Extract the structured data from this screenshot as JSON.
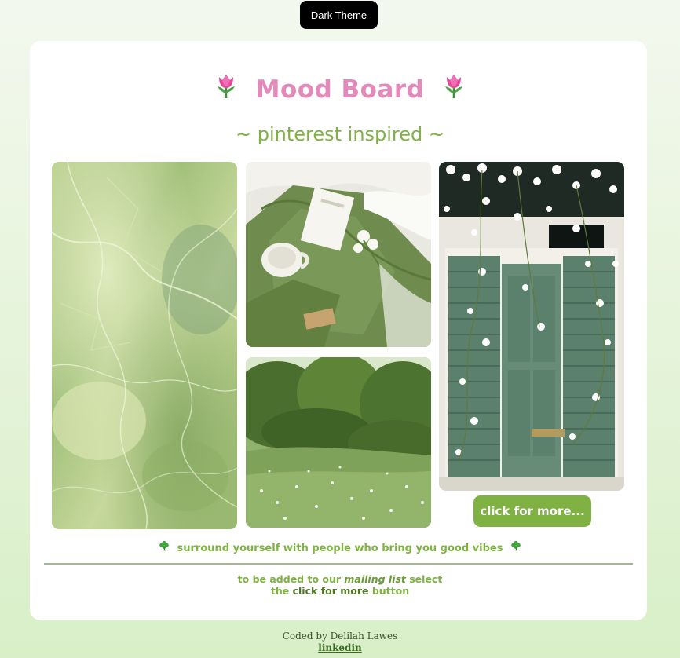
{
  "toolbar": {
    "theme_button_label": "Dark Theme"
  },
  "header": {
    "title": "Mood Board",
    "subtitle": "~ pinterest inspired ~",
    "title_emoji": "🌷"
  },
  "gallery": {
    "images": [
      {
        "name": "green-marble-image"
      },
      {
        "name": "green-apron-flatlay-image"
      },
      {
        "name": "wildflower-meadow-image"
      },
      {
        "name": "green-door-flowers-image"
      }
    ],
    "more_button_label": "click for more..."
  },
  "vibes": {
    "text": "surround yourself with people who bring you good vibes",
    "emoji": "🍀"
  },
  "mailing": {
    "part1": "to be added to our ",
    "list_label": "mailing list",
    "part2": " select",
    "part3": "the ",
    "button_ref": "click for more",
    "part4": " button"
  },
  "footer": {
    "credit": "Coded by Delilah Lawes",
    "link_label": "linkedin"
  },
  "colors": {
    "title_pink": "#e48aba",
    "accent_green": "#7fb143",
    "card_bg": "#ffffff",
    "page_bg": "#e6f3dc"
  }
}
